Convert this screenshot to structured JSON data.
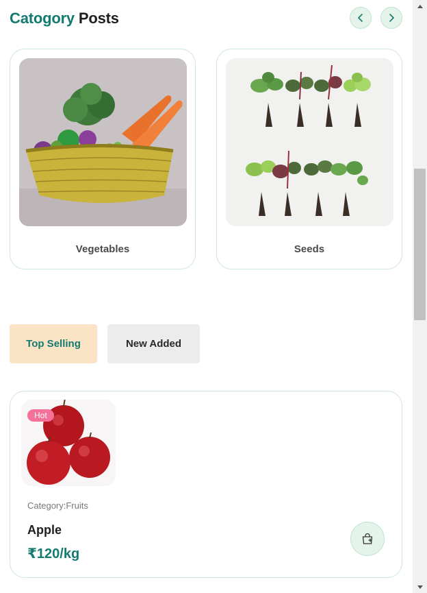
{
  "header": {
    "title_accent": "Catogory",
    "title_rest": "Posts"
  },
  "categories": [
    {
      "label": "Vegetables",
      "image": "vegetable-basket"
    },
    {
      "label": "Seeds",
      "image": "seedlings"
    }
  ],
  "tabs": [
    {
      "label": "Top Selling",
      "active": true
    },
    {
      "label": "New Added",
      "active": false
    }
  ],
  "product": {
    "badge": "Hot",
    "category": "Category:Fruits",
    "name": "Apple",
    "price": "₹120/kg",
    "image": "apples",
    "cart_icon": "shopping-bag-plus-icon"
  },
  "colors": {
    "accent": "#137a70",
    "active_tab_bg": "#fbe3c5",
    "badge": "#f4729a",
    "nav_button_bg": "#e4f4ea"
  }
}
